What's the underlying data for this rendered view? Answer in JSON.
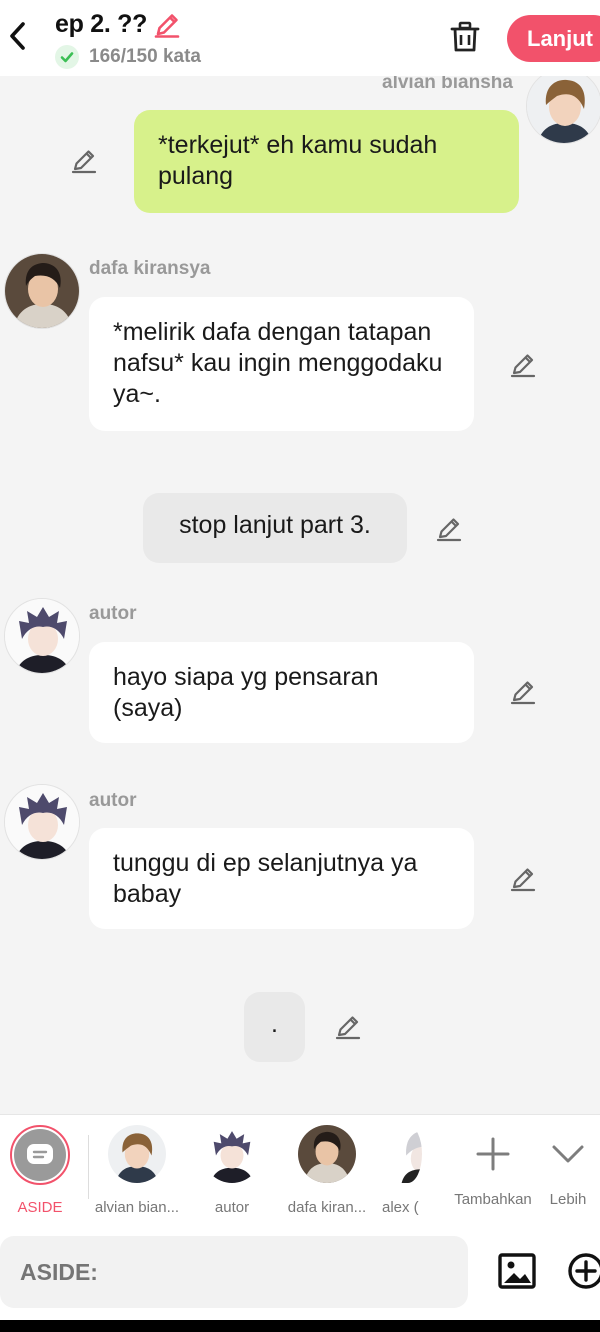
{
  "header": {
    "title": "ep 2. ??",
    "word_count": "166/150 kata",
    "next_label": "Lanjut"
  },
  "messages": [
    {
      "speaker": "alvian biansha",
      "text": "*terkejut* eh kamu sudah pulang",
      "side": "right",
      "style": "green"
    },
    {
      "speaker": "dafa kiransya",
      "text": "*melirik dafa dengan tatapan nafsu* kau ingin menggodaku ya~.",
      "side": "left",
      "style": "white"
    },
    {
      "speaker": "",
      "text": "stop lanjut part 3.",
      "side": "center",
      "style": "gray"
    },
    {
      "speaker": "autor",
      "text": "hayo siapa yg pensaran (saya)",
      "side": "left",
      "style": "white"
    },
    {
      "speaker": "autor",
      "text": "tunggu di ep selanjutnya ya babay",
      "side": "left",
      "style": "white"
    },
    {
      "speaker": "",
      "text": ".",
      "side": "center",
      "style": "gray"
    }
  ],
  "characters": [
    {
      "label": "ASIDE",
      "selected": true
    },
    {
      "label": "alvian bian..."
    },
    {
      "label": "autor"
    },
    {
      "label": "dafa kiran..."
    },
    {
      "label": "alex ("
    },
    {
      "label": "Tambahkan"
    },
    {
      "label": "Lebih"
    }
  ],
  "input": {
    "placeholder": "ASIDE:"
  },
  "colors": {
    "accent": "#f2526b",
    "green_bubble": "#d7f18b",
    "check_green": "#3cbf55"
  },
  "icons": [
    "back-arrow-icon",
    "pencil-icon",
    "check-icon",
    "trash-icon",
    "image-icon",
    "plus-circle-icon",
    "plus-icon",
    "chevron-down-icon",
    "chat-bubble-icon"
  ]
}
